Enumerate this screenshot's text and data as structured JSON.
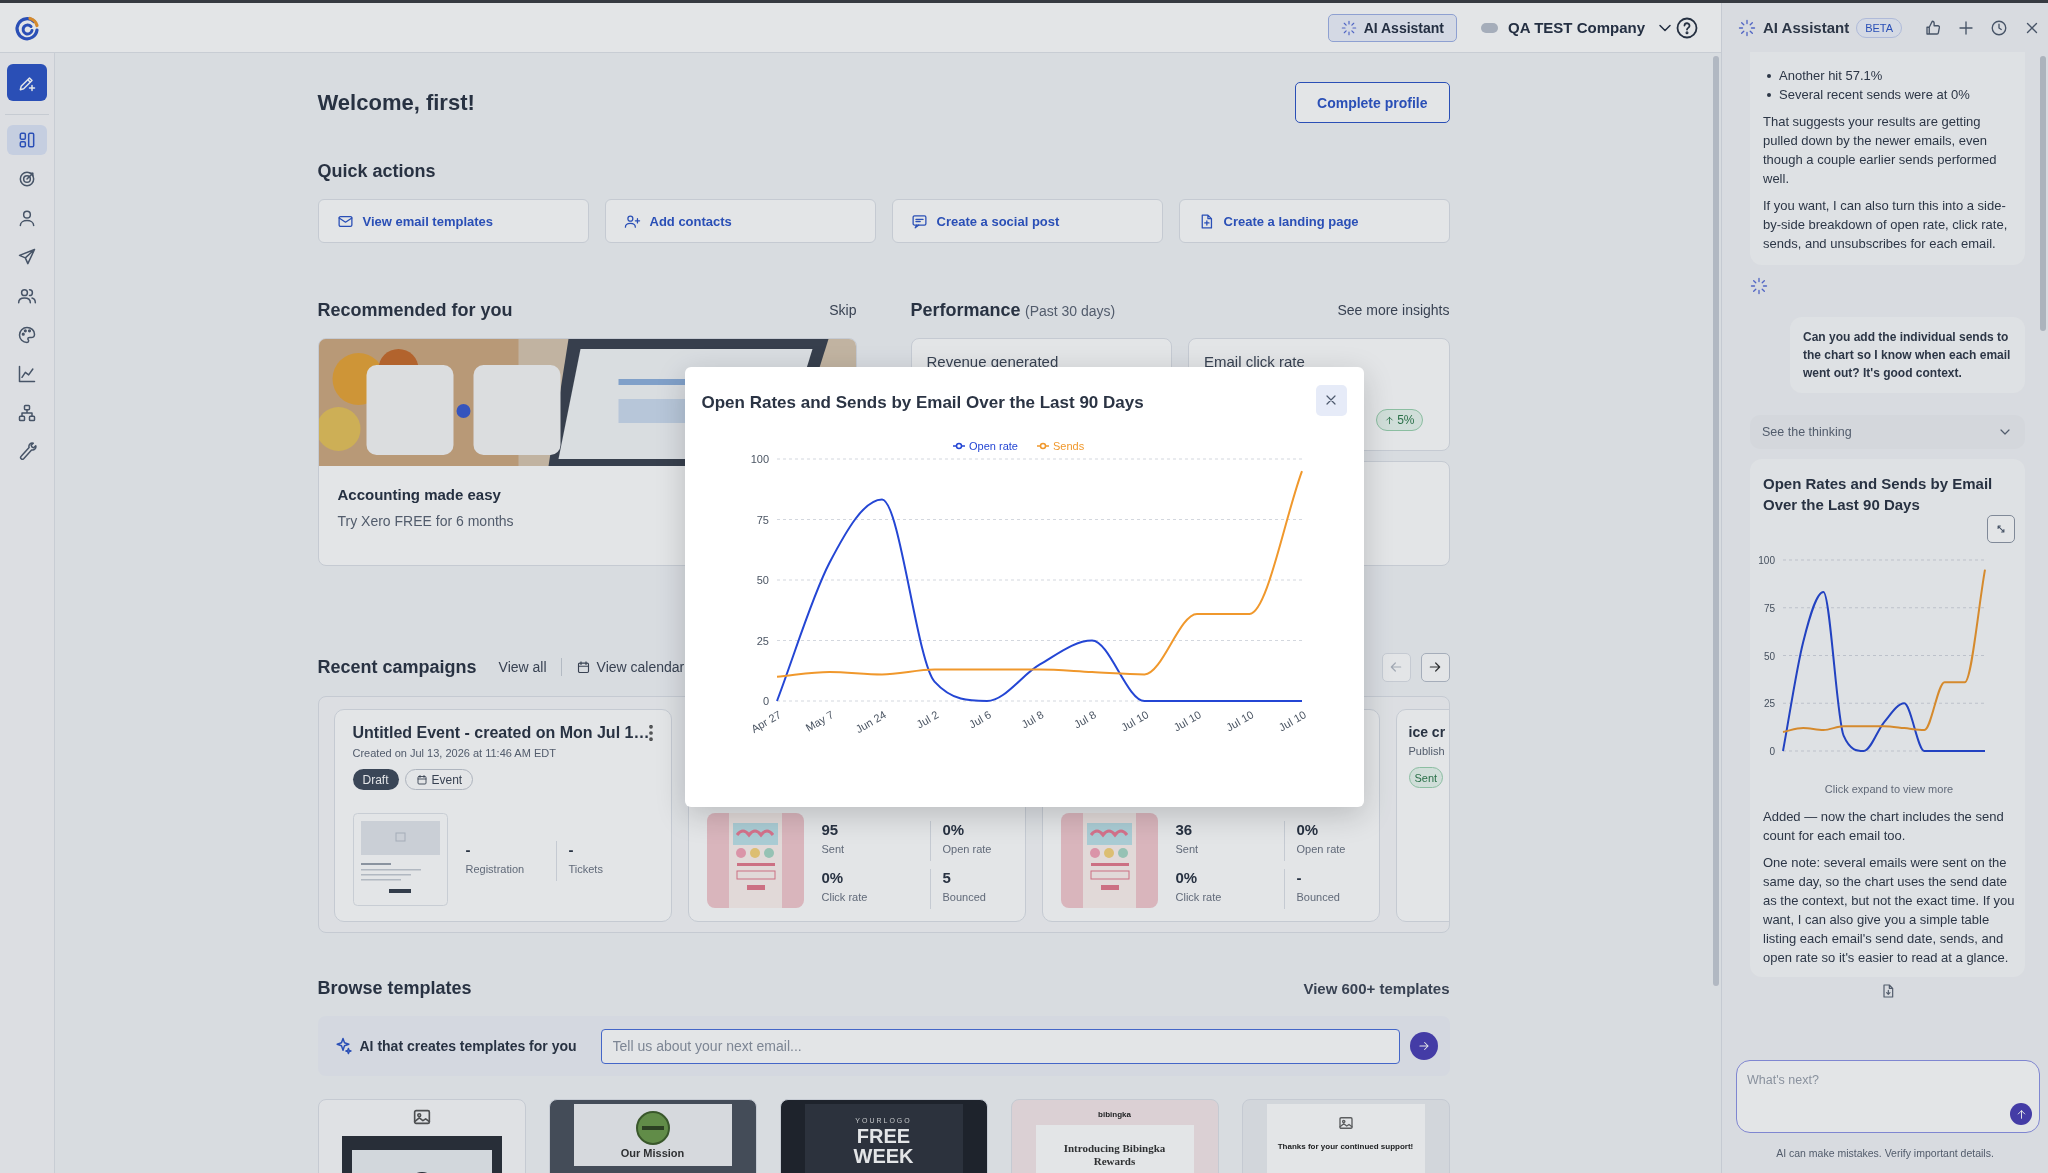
{
  "top_bar": {
    "assistant_button": "AI Assistant",
    "company": "QA TEST Company"
  },
  "sidebar": {
    "items": [
      {
        "kind": "dashboard",
        "selected": true
      },
      {
        "kind": "target",
        "selected": false
      },
      {
        "kind": "person",
        "selected": false
      },
      {
        "kind": "send",
        "selected": false
      },
      {
        "kind": "people",
        "selected": false
      },
      {
        "kind": "palette",
        "selected": false
      },
      {
        "kind": "chart",
        "selected": false
      },
      {
        "kind": "hierarchy",
        "selected": false
      },
      {
        "kind": "wrench",
        "selected": false
      }
    ]
  },
  "main": {
    "welcome": "Welcome, first!",
    "complete_profile": "Complete profile",
    "quick_actions": {
      "title": "Quick actions",
      "items": [
        {
          "kind": "email",
          "label": "View email templates"
        },
        {
          "kind": "contacts",
          "label": "Add contacts"
        },
        {
          "kind": "social",
          "label": "Create a social post"
        },
        {
          "kind": "page",
          "label": "Create a landing page"
        }
      ]
    },
    "recommended": {
      "title": "Recommended for you",
      "skip": "Skip",
      "card": {
        "title": "Accounting made easy",
        "subtitle": "Try Xero FREE for 6 months"
      }
    },
    "performance": {
      "title": "Performance",
      "period": "(Past 30 days)",
      "link": "See more insights",
      "cards": [
        {
          "label": "Revenue generated"
        },
        {
          "label": "Email click rate",
          "badge": "5%"
        }
      ]
    },
    "recent_campaigns": {
      "title": "Recent campaigns",
      "view_all": "View all",
      "view_calendar": "View calendar",
      "nav": [
        {
          "kind": "prev",
          "disabled": true
        },
        {
          "kind": "next",
          "disabled": false
        }
      ],
      "cards": [
        {
          "kind": "event",
          "title": "Untitled Event - created on Mon Jul 1…",
          "created": "Created on Jul 13, 2026 at 11:46 AM EDT",
          "tags": [
            {
              "kind": "status",
              "label": "Draft"
            },
            {
              "kind": "type",
              "label": "Event"
            }
          ],
          "stats": [
            {
              "value": "-",
              "label": "Registration"
            },
            {
              "value": "-",
              "label": "Tickets"
            }
          ]
        },
        {
          "kind": "email",
          "stats": [
            {
              "value": "95",
              "label": "Sent"
            },
            {
              "value": "0%",
              "label": "Open rate"
            },
            {
              "value": "0%",
              "label": "Click rate"
            },
            {
              "value": "5",
              "label": "Bounced"
            }
          ]
        },
        {
          "kind": "email",
          "stats": [
            {
              "value": "36",
              "label": "Sent"
            },
            {
              "value": "0%",
              "label": "Open rate"
            },
            {
              "value": "0%",
              "label": "Click rate"
            },
            {
              "value": "-",
              "label": "Bounced"
            }
          ]
        },
        {
          "kind": "partial",
          "title": "ice cr",
          "subtitle": "Publish",
          "tags": [
            {
              "kind": "sent",
              "label": "Sent"
            }
          ]
        }
      ]
    },
    "browse": {
      "title": "Browse templates",
      "link": "View 600+ templates",
      "ai_label": "AI that creates templates for you",
      "placeholder": "Tell us about your next email...",
      "templates": [
        {
          "kind": "image-header"
        },
        {
          "kind": "mission",
          "heading": "Our Mission"
        },
        {
          "kind": "promo",
          "brand": "YOURLOGO",
          "heading": "FREE WEEK"
        },
        {
          "kind": "announcement",
          "brand": "bibingka",
          "heading": "Introducing Bibingka Rewards"
        },
        {
          "kind": "thanks",
          "heading": "Thanks for your continued support!"
        }
      ]
    }
  },
  "modal": {
    "title": "Open Rates and Sends by Email Over the Last 90 Days",
    "chart_data": {
      "type": "line",
      "categories": [
        "Apr 27",
        "May 7",
        "Jun 24",
        "Jul 2",
        "Jul 6",
        "Jul 8",
        "Jul 8",
        "Jul 10",
        "Jul 10",
        "Jul 10",
        "Jul 10"
      ],
      "series": [
        {
          "name": "Open rate",
          "color": "#2446d4",
          "values": [
            0,
            57.1,
            83.3,
            8,
            0,
            15,
            25,
            0,
            0,
            0,
            0
          ]
        },
        {
          "name": "Sends",
          "color": "#f0982c",
          "values": [
            10,
            12,
            11,
            13,
            13,
            13,
            12,
            11,
            36,
            36,
            95
          ]
        }
      ],
      "ylim": [
        0,
        100
      ],
      "yticks": [
        0,
        25,
        50,
        75,
        100
      ],
      "grid": true,
      "legend": true
    }
  },
  "panel": {
    "title": "AI Assistant",
    "badge": "BETA",
    "messages": [
      {
        "kind": "assistant",
        "bullets": [
          "Another hit 57.1%",
          "Several recent sends were at 0%"
        ],
        "paragraphs": [
          "That suggests your results are getting pulled down by the newer emails, even though a couple earlier sends performed well.",
          "If you want, I can also turn this into a side-by-side breakdown of open rate, click rate, sends, and unsubscribes for each email."
        ]
      },
      {
        "kind": "user",
        "text": "Can you add the individual sends to the chart so I know when each email went out? It's good context."
      },
      {
        "kind": "thinking",
        "label": "See the thinking",
        "expanded": false
      },
      {
        "kind": "chart",
        "title": "Open Rates and Sends by Email Over the Last 90 Days",
        "caption": "Click expand to view more",
        "chart_data": {
          "type": "line",
          "series": [
            {
              "color": "#2446d4",
              "values": [
                0,
                57.1,
                83.3,
                8,
                0,
                15,
                25,
                0,
                0,
                0,
                0
              ]
            },
            {
              "color": "#f0982c",
              "values": [
                10,
                12,
                11,
                13,
                13,
                13,
                12,
                11,
                36,
                36,
                95
              ]
            }
          ],
          "ylim": [
            0,
            100
          ],
          "yticks": [
            0,
            25,
            50,
            75,
            100
          ],
          "grid": true
        },
        "paragraphs": [
          "Added — now the chart includes the send count for each email too.",
          "One note: several emails were sent on the same day, so the chart uses the send date as the context, but not the exact time. If you want, I can also give you a simple table listing each email's send date, sends, and open rate so it's easier to read at a glance."
        ]
      }
    ],
    "input_placeholder": "What's next?",
    "disclaimer": "AI can make mistakes. Verify important details."
  }
}
